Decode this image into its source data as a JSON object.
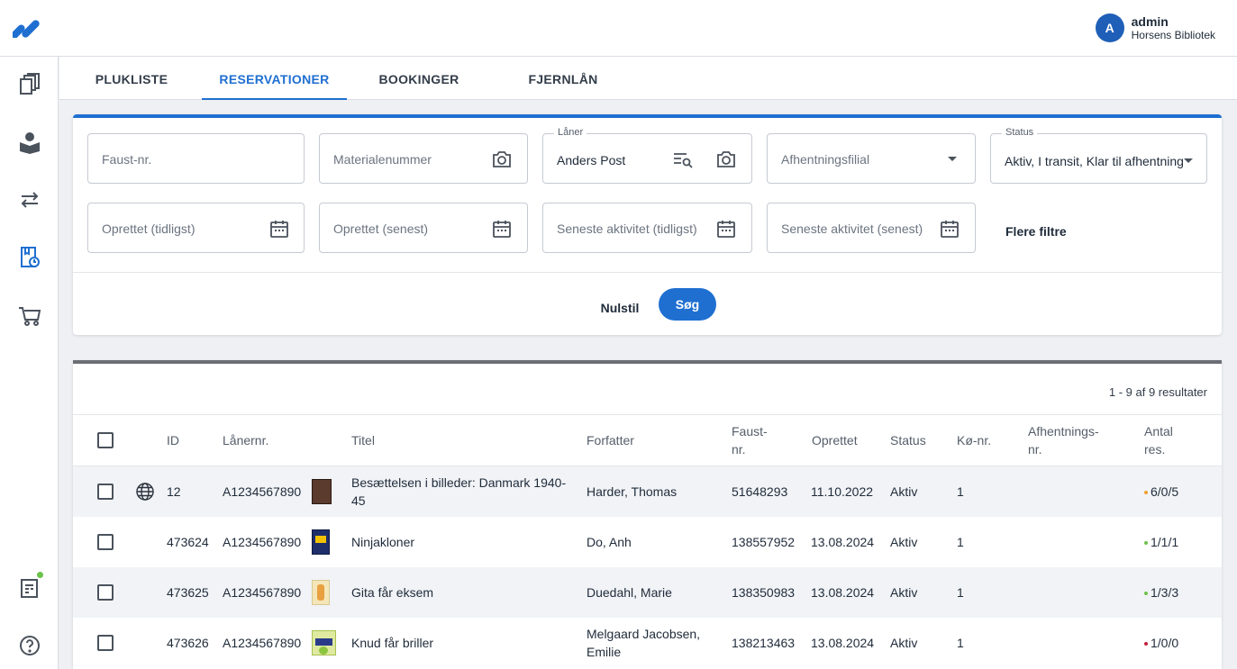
{
  "user": {
    "initial": "A",
    "name": "admin",
    "library": "Horsens Bibliotek"
  },
  "icons": {
    "logo": "app-logo",
    "sidebar": [
      "books-icon",
      "reader-icon",
      "transfer-arrows-icon",
      "reservation-clock-icon",
      "cart-icon",
      "report-icon",
      "help-icon"
    ]
  },
  "tabs": [
    {
      "label": "PLUKLISTE",
      "active": false
    },
    {
      "label": "RESERVATIONER",
      "active": true
    },
    {
      "label": "BOOKINGER",
      "active": false
    },
    {
      "label": "FJERNLÅN",
      "active": false
    }
  ],
  "filters": {
    "faust": {
      "placeholder": "Faust-nr."
    },
    "material": {
      "placeholder": "Materialenummer"
    },
    "borrower": {
      "label": "Låner",
      "value": "Anders Post"
    },
    "pickup_branch": {
      "placeholder": "Afhentningsfilial"
    },
    "status": {
      "label": "Status",
      "value": "Aktiv, I transit, Klar til afhentning"
    },
    "created_from": {
      "placeholder": "Oprettet (tidligst)"
    },
    "created_to": {
      "placeholder": "Oprettet (senest)"
    },
    "activity_from": {
      "placeholder": "Seneste aktivitet (tidligst)"
    },
    "activity_to": {
      "placeholder": "Seneste aktivitet (senest)"
    },
    "more_filters": "Flere filtre",
    "reset_label": "Nulstil",
    "search_label": "Søg"
  },
  "results": {
    "count_text": "1 - 9 af 9 resultater",
    "headers": {
      "id": "ID",
      "borrower_no": "Lånernr.",
      "title": "Titel",
      "author": "Forfatter",
      "faust_1": "Faust-",
      "faust_2": "nr.",
      "created": "Oprettet",
      "status": "Status",
      "queue": "Kø-nr.",
      "pickup_1": "Afhentnings-",
      "pickup_2": "nr.",
      "count_1": "Antal",
      "count_2": "res."
    },
    "rows": [
      {
        "id": "12",
        "borrower_no": "A1234567890",
        "title_1": "Besættelsen i billeder: Danmark 1940-",
        "title_2": "45",
        "author_1": "Harder, Thomas",
        "author_2": "",
        "faust": "51648293",
        "created": "11.10.2022",
        "status": "Aktiv",
        "queue": "1",
        "count": "6/0/5",
        "dot_color": "#f0a030",
        "global": true,
        "thumb_color": "#5a3b2e"
      },
      {
        "id": "473624",
        "borrower_no": "A1234567890",
        "title_1": "Ninjakloner",
        "title_2": "",
        "author_1": "Do, Anh",
        "author_2": "",
        "faust": "138557952",
        "created": "13.08.2024",
        "status": "Aktiv",
        "queue": "1",
        "count": "1/1/1",
        "dot_color": "#6cc24a",
        "global": false,
        "thumb_color": "#1d2e6b"
      },
      {
        "id": "473625",
        "borrower_no": "A1234567890",
        "title_1": "Gita får eksem",
        "title_2": "",
        "author_1": "Duedahl, Marie",
        "author_2": "",
        "faust": "138350983",
        "created": "13.08.2024",
        "status": "Aktiv",
        "queue": "1",
        "count": "1/3/3",
        "dot_color": "#6cc24a",
        "global": false,
        "thumb_color": "#e8c870"
      },
      {
        "id": "473626",
        "borrower_no": "A1234567890",
        "title_1": "Knud får briller",
        "title_2": "",
        "author_1": "Melgaard Jacobsen,",
        "author_2": "Emilie",
        "faust": "138213463",
        "created": "13.08.2024",
        "status": "Aktiv",
        "queue": "1",
        "count": "1/0/0",
        "dot_color": "#c0203a",
        "global": false,
        "thumb_color": "#8cc63f"
      }
    ]
  }
}
